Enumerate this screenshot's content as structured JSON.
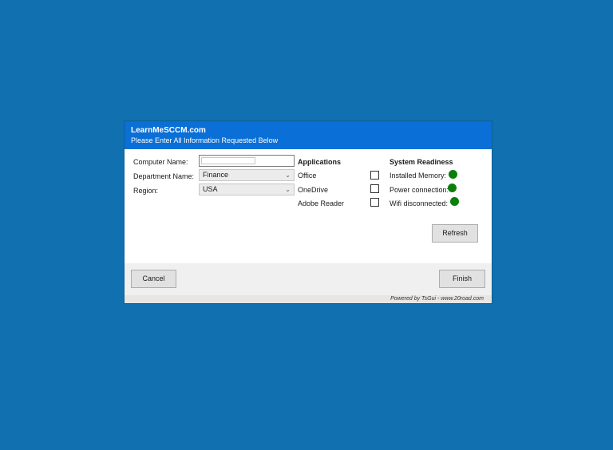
{
  "header": {
    "title": "LearnMeSCCM.com",
    "subtitle": "Please Enter All Information Requested Below"
  },
  "form": {
    "computer_name_label": "Computer Name:",
    "computer_name_value": "",
    "department_label": "Department Name:",
    "department_value": "Finance",
    "region_label": "Region:",
    "region_value": "USA"
  },
  "applications": {
    "heading": "Applications",
    "items": [
      {
        "label": "Office",
        "checked": false
      },
      {
        "label": "OneDrive",
        "checked": false
      },
      {
        "label": "Adobe Reader",
        "checked": false
      }
    ]
  },
  "readiness": {
    "heading": "System Readiness",
    "items": [
      {
        "label": "Installed Memory:",
        "status_color": "#0a7f0a"
      },
      {
        "label": "Power connection:",
        "status_color": "#0a7f0a"
      },
      {
        "label": "Wifi disconnected:",
        "status_color": "#0a7f0a"
      }
    ]
  },
  "buttons": {
    "refresh": "Refresh",
    "cancel": "Cancel",
    "finish": "Finish"
  },
  "footer": {
    "powered_by": "Powered by TsGui - www.20road.com"
  },
  "colors": {
    "desktop": "#1070b0",
    "header": "#0a6fd6"
  }
}
